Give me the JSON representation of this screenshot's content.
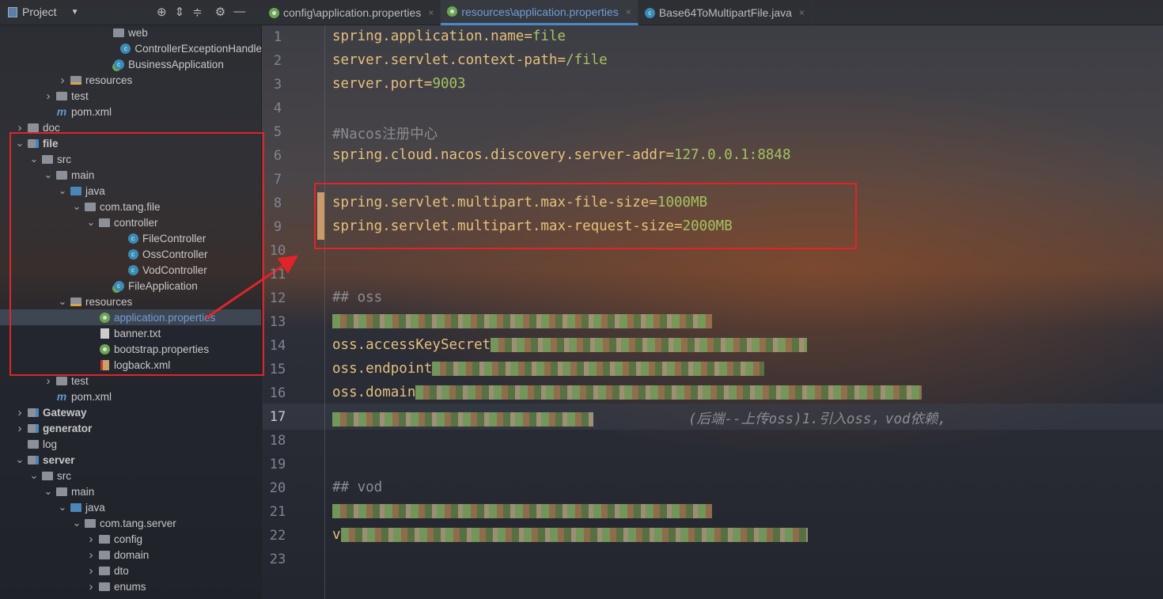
{
  "toolbar": {
    "project_label": "Project",
    "icons": [
      "crosshair-icon",
      "expand-all-icon",
      "collapse-all-icon",
      "gear-icon",
      "minimize-icon"
    ]
  },
  "tabs": [
    {
      "label": "config\\application.properties",
      "icon": "properties-icon",
      "active": false
    },
    {
      "label": "resources\\application.properties",
      "icon": "properties-icon",
      "active": true
    },
    {
      "label": "Base64ToMultipartFile.java",
      "icon": "class-icon",
      "active": false
    }
  ],
  "tree": [
    {
      "label": "web",
      "type": "folder",
      "depth": 6,
      "arrow": ""
    },
    {
      "label": "ControllerExceptionHandle",
      "type": "class",
      "depth": 7,
      "arrow": ""
    },
    {
      "label": "BusinessApplication",
      "type": "springclass",
      "depth": 6,
      "arrow": ""
    },
    {
      "label": "resources",
      "type": "res",
      "depth": 3,
      "arrow": "collapsed"
    },
    {
      "label": "test",
      "type": "folder",
      "depth": 2,
      "arrow": "collapsed"
    },
    {
      "label": "pom.xml",
      "type": "maven",
      "depth": 2,
      "arrow": ""
    },
    {
      "label": "doc",
      "type": "folder",
      "depth": 0,
      "arrow": "collapsed"
    },
    {
      "label": "file",
      "type": "module",
      "depth": 0,
      "arrow": "expanded",
      "bold": true
    },
    {
      "label": "src",
      "type": "folder",
      "depth": 1,
      "arrow": "expanded"
    },
    {
      "label": "main",
      "type": "folder",
      "depth": 2,
      "arrow": "expanded"
    },
    {
      "label": "java",
      "type": "source",
      "depth": 3,
      "arrow": "expanded"
    },
    {
      "label": "com.tang.file",
      "type": "folder",
      "depth": 4,
      "arrow": "expanded"
    },
    {
      "label": "controller",
      "type": "folder",
      "depth": 5,
      "arrow": "expanded"
    },
    {
      "label": "FileController",
      "type": "class",
      "depth": 7,
      "arrow": ""
    },
    {
      "label": "OssController",
      "type": "class",
      "depth": 7,
      "arrow": ""
    },
    {
      "label": "VodController",
      "type": "class",
      "depth": 7,
      "arrow": ""
    },
    {
      "label": "FileApplication",
      "type": "springclass",
      "depth": 6,
      "arrow": ""
    },
    {
      "label": "resources",
      "type": "res",
      "depth": 3,
      "arrow": "expanded"
    },
    {
      "label": "application.properties",
      "type": "properties",
      "depth": 5,
      "arrow": "",
      "selected": true
    },
    {
      "label": "banner.txt",
      "type": "text",
      "depth": 5,
      "arrow": ""
    },
    {
      "label": "bootstrap.properties",
      "type": "properties",
      "depth": 5,
      "arrow": ""
    },
    {
      "label": "logback.xml",
      "type": "log",
      "depth": 5,
      "arrow": ""
    },
    {
      "label": "test",
      "type": "folder",
      "depth": 2,
      "arrow": "collapsed"
    },
    {
      "label": "pom.xml",
      "type": "maven",
      "depth": 2,
      "arrow": ""
    },
    {
      "label": "Gateway",
      "type": "module",
      "depth": 0,
      "arrow": "collapsed",
      "bold": true
    },
    {
      "label": "generator",
      "type": "module",
      "depth": 0,
      "arrow": "collapsed",
      "bold": true
    },
    {
      "label": "log",
      "type": "folder",
      "depth": 0,
      "arrow": ""
    },
    {
      "label": "server",
      "type": "module",
      "depth": 0,
      "arrow": "expanded",
      "bold": true
    },
    {
      "label": "src",
      "type": "folder",
      "depth": 1,
      "arrow": "expanded"
    },
    {
      "label": "main",
      "type": "folder",
      "depth": 2,
      "arrow": "expanded"
    },
    {
      "label": "java",
      "type": "source",
      "depth": 3,
      "arrow": "expanded"
    },
    {
      "label": "com.tang.server",
      "type": "folder",
      "depth": 4,
      "arrow": "expanded"
    },
    {
      "label": "config",
      "type": "folder",
      "depth": 5,
      "arrow": "collapsed"
    },
    {
      "label": "domain",
      "type": "folder",
      "depth": 5,
      "arrow": "collapsed"
    },
    {
      "label": "dto",
      "type": "folder",
      "depth": 5,
      "arrow": "collapsed"
    },
    {
      "label": "enums",
      "type": "folder",
      "depth": 5,
      "arrow": "collapsed"
    }
  ],
  "editor": {
    "lines": [
      {
        "n": "1",
        "key": "spring.application.name",
        "val": "file"
      },
      {
        "n": "2",
        "key": "server.servlet.context-path",
        "val": "/file"
      },
      {
        "n": "3",
        "key": "server.port",
        "val": "9003"
      },
      {
        "n": "4"
      },
      {
        "n": "5",
        "comment": "#Nacos注册中心"
      },
      {
        "n": "6",
        "key": "spring.cloud.nacos.discovery.server-addr",
        "val": "127.0.0.1:8848"
      },
      {
        "n": "7"
      },
      {
        "n": "8",
        "key": "spring.servlet.multipart.max-file-size",
        "val": "1000MB",
        "changed": true
      },
      {
        "n": "9",
        "key": "spring.servlet.multipart.max-request-size",
        "val": "2000MB",
        "changed": true
      },
      {
        "n": "10"
      },
      {
        "n": "11"
      },
      {
        "n": "12",
        "comment": "## oss"
      },
      {
        "n": "13",
        "redacted": "",
        "blurw": 480
      },
      {
        "n": "14",
        "redacted": "oss.accessKeySecret",
        "blurw": 400
      },
      {
        "n": "15",
        "redacted": "oss.endpoint",
        "blurw": 420
      },
      {
        "n": "16",
        "redacted": "oss.domain",
        "blurw": 640
      },
      {
        "n": "17",
        "redacted": "",
        "blurw": 330,
        "blame": "(后端--上传oss)1.引入oss，vod依赖,"
      },
      {
        "n": "18"
      },
      {
        "n": "19"
      },
      {
        "n": "20",
        "comment": "## vod"
      },
      {
        "n": "21",
        "redacted": "",
        "blurw": 480
      },
      {
        "n": "22",
        "redacted": "v",
        "blurw": 590
      },
      {
        "n": "23"
      }
    ]
  },
  "colors": {
    "highlight_box": "#e0242a",
    "tab_active": "#6f9ed6"
  }
}
